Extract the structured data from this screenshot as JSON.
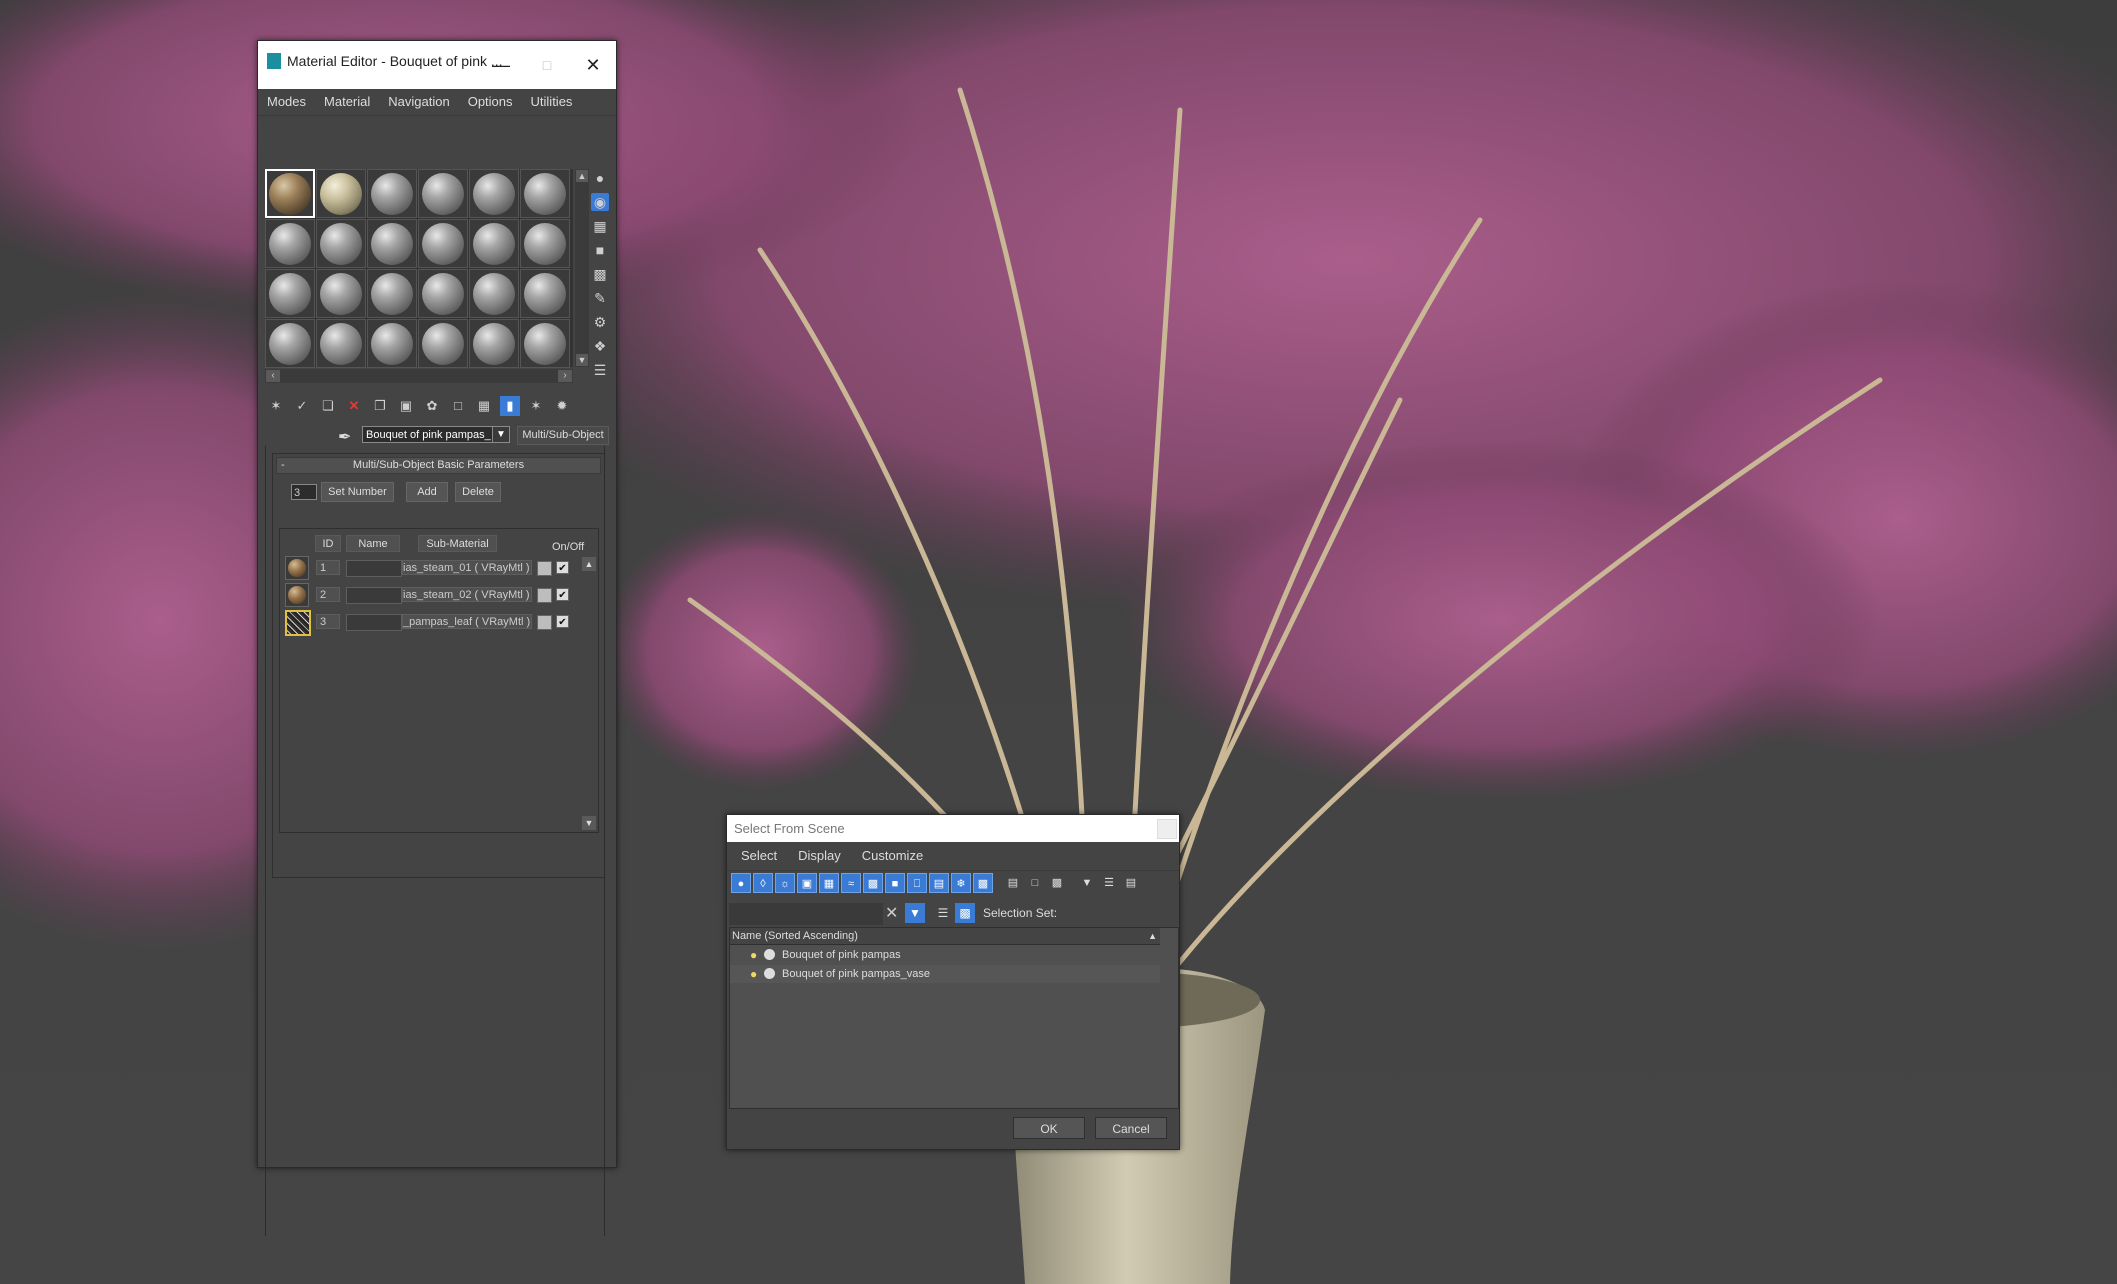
{
  "material_editor": {
    "title": "Material Editor - Bouquet of pink ...",
    "menu": [
      "Modes",
      "Material",
      "Navigation",
      "Options",
      "Utilities"
    ],
    "material_name": "Bouquet of pink pampas_",
    "material_type": "Multi/Sub-Object",
    "rollout_title": "Multi/Sub-Object Basic Parameters",
    "set_number_value": "3",
    "buttons": {
      "set_number": "Set Number",
      "add": "Add",
      "delete": "Delete"
    },
    "columns": {
      "id": "ID",
      "name": "Name",
      "sub_material": "Sub-Material",
      "on_off": "On/Off"
    },
    "rows": [
      {
        "id": "1",
        "sub_material": "ias_steam_01  ( VRayMtl )"
      },
      {
        "id": "2",
        "sub_material": "ias_steam_02  ( VRayMtl )"
      },
      {
        "id": "3",
        "sub_material": "_pampas_leaf  ( VRayMtl )"
      }
    ]
  },
  "select_from_scene": {
    "title": "Select From Scene",
    "menu": [
      "Select",
      "Display",
      "Customize"
    ],
    "selection_set_label": "Selection Set:",
    "column_header": "Name (Sorted Ascending)",
    "items": [
      "Bouquet of pink pampas",
      "Bouquet of pink pampas_vase"
    ],
    "ok": "OK",
    "cancel": "Cancel"
  }
}
